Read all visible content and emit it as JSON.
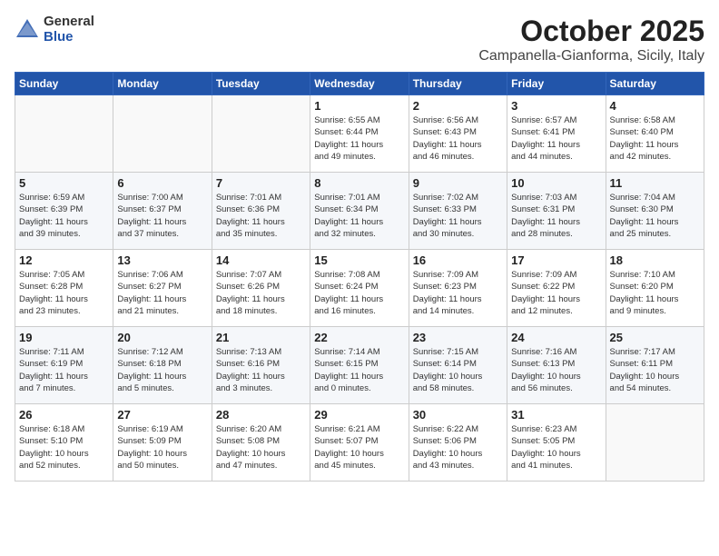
{
  "header": {
    "logo_general": "General",
    "logo_blue": "Blue",
    "month": "October 2025",
    "location": "Campanella-Gianforma, Sicily, Italy"
  },
  "days_of_week": [
    "Sunday",
    "Monday",
    "Tuesday",
    "Wednesday",
    "Thursday",
    "Friday",
    "Saturday"
  ],
  "weeks": [
    [
      {
        "day": "",
        "info": ""
      },
      {
        "day": "",
        "info": ""
      },
      {
        "day": "",
        "info": ""
      },
      {
        "day": "1",
        "info": "Sunrise: 6:55 AM\nSunset: 6:44 PM\nDaylight: 11 hours\nand 49 minutes."
      },
      {
        "day": "2",
        "info": "Sunrise: 6:56 AM\nSunset: 6:43 PM\nDaylight: 11 hours\nand 46 minutes."
      },
      {
        "day": "3",
        "info": "Sunrise: 6:57 AM\nSunset: 6:41 PM\nDaylight: 11 hours\nand 44 minutes."
      },
      {
        "day": "4",
        "info": "Sunrise: 6:58 AM\nSunset: 6:40 PM\nDaylight: 11 hours\nand 42 minutes."
      }
    ],
    [
      {
        "day": "5",
        "info": "Sunrise: 6:59 AM\nSunset: 6:39 PM\nDaylight: 11 hours\nand 39 minutes."
      },
      {
        "day": "6",
        "info": "Sunrise: 7:00 AM\nSunset: 6:37 PM\nDaylight: 11 hours\nand 37 minutes."
      },
      {
        "day": "7",
        "info": "Sunrise: 7:01 AM\nSunset: 6:36 PM\nDaylight: 11 hours\nand 35 minutes."
      },
      {
        "day": "8",
        "info": "Sunrise: 7:01 AM\nSunset: 6:34 PM\nDaylight: 11 hours\nand 32 minutes."
      },
      {
        "day": "9",
        "info": "Sunrise: 7:02 AM\nSunset: 6:33 PM\nDaylight: 11 hours\nand 30 minutes."
      },
      {
        "day": "10",
        "info": "Sunrise: 7:03 AM\nSunset: 6:31 PM\nDaylight: 11 hours\nand 28 minutes."
      },
      {
        "day": "11",
        "info": "Sunrise: 7:04 AM\nSunset: 6:30 PM\nDaylight: 11 hours\nand 25 minutes."
      }
    ],
    [
      {
        "day": "12",
        "info": "Sunrise: 7:05 AM\nSunset: 6:28 PM\nDaylight: 11 hours\nand 23 minutes."
      },
      {
        "day": "13",
        "info": "Sunrise: 7:06 AM\nSunset: 6:27 PM\nDaylight: 11 hours\nand 21 minutes."
      },
      {
        "day": "14",
        "info": "Sunrise: 7:07 AM\nSunset: 6:26 PM\nDaylight: 11 hours\nand 18 minutes."
      },
      {
        "day": "15",
        "info": "Sunrise: 7:08 AM\nSunset: 6:24 PM\nDaylight: 11 hours\nand 16 minutes."
      },
      {
        "day": "16",
        "info": "Sunrise: 7:09 AM\nSunset: 6:23 PM\nDaylight: 11 hours\nand 14 minutes."
      },
      {
        "day": "17",
        "info": "Sunrise: 7:09 AM\nSunset: 6:22 PM\nDaylight: 11 hours\nand 12 minutes."
      },
      {
        "day": "18",
        "info": "Sunrise: 7:10 AM\nSunset: 6:20 PM\nDaylight: 11 hours\nand 9 minutes."
      }
    ],
    [
      {
        "day": "19",
        "info": "Sunrise: 7:11 AM\nSunset: 6:19 PM\nDaylight: 11 hours\nand 7 minutes."
      },
      {
        "day": "20",
        "info": "Sunrise: 7:12 AM\nSunset: 6:18 PM\nDaylight: 11 hours\nand 5 minutes."
      },
      {
        "day": "21",
        "info": "Sunrise: 7:13 AM\nSunset: 6:16 PM\nDaylight: 11 hours\nand 3 minutes."
      },
      {
        "day": "22",
        "info": "Sunrise: 7:14 AM\nSunset: 6:15 PM\nDaylight: 11 hours\nand 0 minutes."
      },
      {
        "day": "23",
        "info": "Sunrise: 7:15 AM\nSunset: 6:14 PM\nDaylight: 10 hours\nand 58 minutes."
      },
      {
        "day": "24",
        "info": "Sunrise: 7:16 AM\nSunset: 6:13 PM\nDaylight: 10 hours\nand 56 minutes."
      },
      {
        "day": "25",
        "info": "Sunrise: 7:17 AM\nSunset: 6:11 PM\nDaylight: 10 hours\nand 54 minutes."
      }
    ],
    [
      {
        "day": "26",
        "info": "Sunrise: 6:18 AM\nSunset: 5:10 PM\nDaylight: 10 hours\nand 52 minutes."
      },
      {
        "day": "27",
        "info": "Sunrise: 6:19 AM\nSunset: 5:09 PM\nDaylight: 10 hours\nand 50 minutes."
      },
      {
        "day": "28",
        "info": "Sunrise: 6:20 AM\nSunset: 5:08 PM\nDaylight: 10 hours\nand 47 minutes."
      },
      {
        "day": "29",
        "info": "Sunrise: 6:21 AM\nSunset: 5:07 PM\nDaylight: 10 hours\nand 45 minutes."
      },
      {
        "day": "30",
        "info": "Sunrise: 6:22 AM\nSunset: 5:06 PM\nDaylight: 10 hours\nand 43 minutes."
      },
      {
        "day": "31",
        "info": "Sunrise: 6:23 AM\nSunset: 5:05 PM\nDaylight: 10 hours\nand 41 minutes."
      },
      {
        "day": "",
        "info": ""
      }
    ]
  ]
}
